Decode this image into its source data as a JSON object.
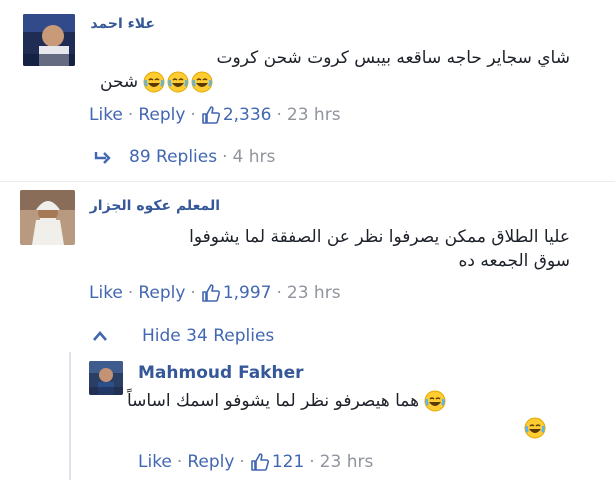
{
  "comments": [
    {
      "author": "علاء احمد",
      "line1": "شاي سجاير حاجه ساقعه بيبس كروت شحن كروت",
      "line2": "شحن",
      "emoji_count": 3,
      "like": "Like",
      "reply": "Reply",
      "likes": "2,336",
      "time": "23 hrs",
      "replies_label": "89 Replies",
      "replies_time": "4 hrs"
    },
    {
      "author": "المعلم عكوه الجزار",
      "line1": "عليا الطلاق ممكن يصرفوا نظر عن الصفقة لما يشوفوا",
      "line2": "سوق الجمعه ده",
      "like": "Like",
      "reply": "Reply",
      "likes": "1,997",
      "time": "23 hrs",
      "hide_label": "Hide 34 Replies"
    }
  ],
  "reply": {
    "author": "Mahmoud Fakher",
    "line1": "هما هيصرفو نظر لما يشوفو اسمك اساساً",
    "like": "Like",
    "reply": "Reply",
    "likes": "121",
    "time": "23 hrs"
  },
  "colors": {
    "link": "#4267b2",
    "name": "#365899",
    "meta": "#90949c",
    "text": "#1d2129"
  }
}
